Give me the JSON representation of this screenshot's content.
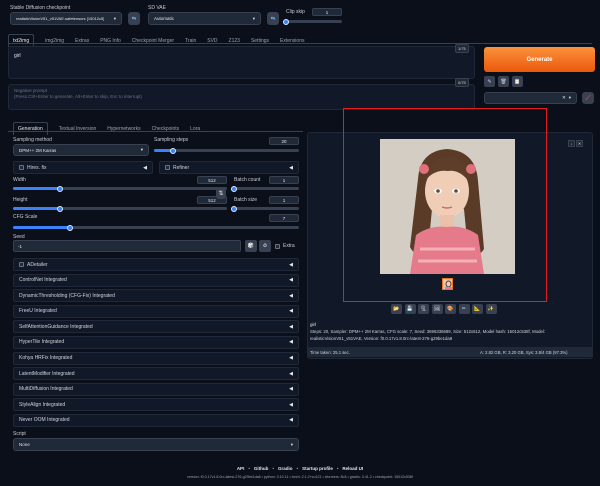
{
  "header": {
    "checkpoint_label": "Stable Diffusion checkpoint",
    "checkpoint_value": "realisticVisionV51_v51VAE.safetensors [15012c5]",
    "vae_label": "SD VAE",
    "vae_value": "Automatic",
    "clip_label": "Clip skip",
    "clip_value": "1",
    "clip_fraction": 0.0
  },
  "main_tabs": [
    "txt2img",
    "img2img",
    "Extras",
    "PNG Info",
    "Checkpoint Merger",
    "Train",
    "SVD",
    "Z123",
    "Settings",
    "Extensions"
  ],
  "prompt": {
    "value": "girl",
    "counter": "1/75",
    "neg_placeholder": "Negative prompt\n(Press Ctrl+Enter to generate, Alt+Enter to skip, Esc to interrupt)",
    "neg_counter": "0/75"
  },
  "generate_label": "Generate",
  "style_icons": [
    "pencil-icon",
    "trash-icon",
    "clipboard-icon"
  ],
  "sub_tabs": [
    "Generation",
    "Textual Inversion",
    "Hypernetworks",
    "Checkpoints",
    "Lora"
  ],
  "settings": {
    "sampling_method_label": "Sampling method",
    "sampling_method_value": "DPM++ 2M Karras",
    "sampling_steps_label": "Sampling steps",
    "sampling_steps_value": "20",
    "sampling_steps_fraction": 0.13,
    "hires_label": "Hires. fix",
    "refiner_label": "Refiner",
    "width_label": "Width",
    "width_value": "512",
    "width_fraction": 0.22,
    "height_label": "Height",
    "height_value": "512",
    "height_fraction": 0.22,
    "batch_count_label": "Batch count",
    "batch_count_value": "1",
    "batch_count_fraction": 0.0,
    "batch_size_label": "Batch size",
    "batch_size_value": "1",
    "batch_size_fraction": 0.0,
    "cfg_label": "CFG Scale",
    "cfg_value": "7",
    "cfg_fraction": 0.2,
    "seed_label": "Seed",
    "seed_value": "-1",
    "extra_label": "Extra"
  },
  "accordions": [
    "ADetailer",
    "ControlNet Integrated",
    "DynamicThresholding (CFG-Fix) Integrated",
    "FreeU Integrated",
    "SelfAttentionGuidance Integrated",
    "HyperTile Integrated",
    "Kohya HRFix Integrated",
    "LatentModifier Integrated",
    "MultiDiffusion Integrated",
    "StyleAlign Integrated",
    "Never OOM Integrated"
  ],
  "script": {
    "label": "Script",
    "value": "None"
  },
  "output": {
    "info_prompt": "girl",
    "info_params": "Steps: 20, Sampler: DPM++ 2M Karras, CFG scale: 7, Seed: 3696336689, Size: 512x512, Model hash: 15012c538f, Model: realisticVisionV51_v51VAE, Version: f0.0.17v1.8.0rc-latest-276-g29be1da8",
    "time_taken": "Time taken: 25.1 sec.",
    "vram": "A: 2.82 GB, R: 3.20 GB, Sys: 3.8/4 GB (97.3%)",
    "tool_icons": [
      "folder-icon",
      "save-icon",
      "zip-icon",
      "image-icon",
      "palette-icon",
      "paint-icon",
      "ruler-icon",
      "star-icon"
    ]
  },
  "footer": {
    "links": [
      "API",
      "Github",
      "Gradio",
      "Startup profile",
      "Reload UI"
    ],
    "version": "version: f0.0.17v1.8.0rc-latest-276-g29be1da8  •  python: 3.10.11  •  torch: 2.1.2+cu121  •  xformers: N/A  •  gradio: 3.41.2  •  checkpoint: 15012c538f"
  },
  "colors": {
    "accent": "#f97316",
    "highlight_box": "#e11d1d",
    "slider": "#3b82f6"
  }
}
